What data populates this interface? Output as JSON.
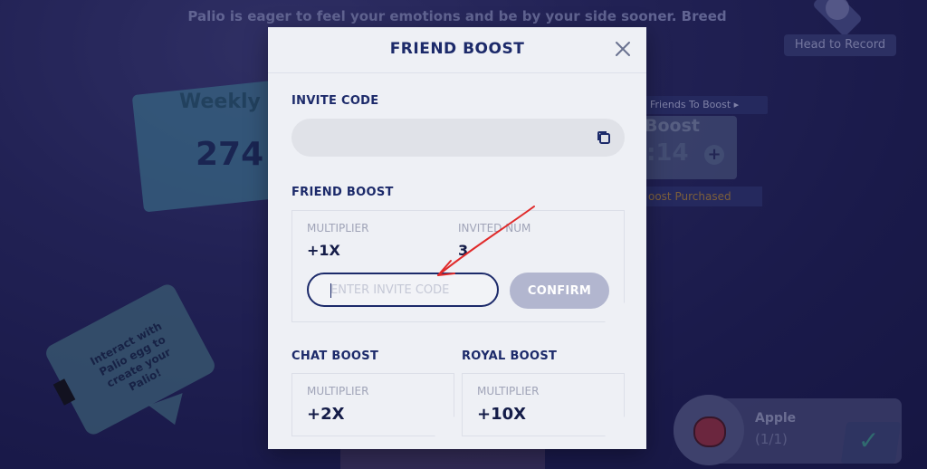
{
  "background": {
    "message": "Palio is eager to feel your emotions and be by your side sooner. Breed your Palio!",
    "weekly_title": "Weekly",
    "weekly_value": "274",
    "head_to_record": "Head to Record",
    "invite_friends_tag": "Friends To Boost",
    "boost_title": "Boost",
    "boost_value": "14",
    "boost_purchased": "oost Purchased",
    "bubble_text": "Interact with Palio egg to create your Palio!",
    "apple_name": "Apple",
    "apple_count": "(1/1)"
  },
  "modal": {
    "title": "FRIEND BOOST",
    "invite_code_label": "INVITE CODE",
    "invite_code_value": "",
    "friend_boost_label": "FRIEND BOOST",
    "friend_boost": {
      "multiplier_label": "MULTIPLIER",
      "multiplier_value": "+1X",
      "invited_label": "INVITED NUM",
      "invited_value": "3",
      "input_placeholder": "ENTER INVITE CODE",
      "confirm_label": "CONFIRM"
    },
    "chat_boost": {
      "label": "CHAT BOOST",
      "multiplier_label": "MULTIPLIER",
      "multiplier_value": "+2X"
    },
    "royal_boost": {
      "label": "ROYAL BOOST",
      "multiplier_label": "MULTIPLIER",
      "multiplier_value": "+10X"
    }
  },
  "colors": {
    "navy": "#1c2a6a",
    "modal_bg": "#eef0f5",
    "confirm_disabled": "#b2b6cf",
    "annotation_arrow": "#e02a2a"
  },
  "icons": [
    "close-icon",
    "copy-icon",
    "fist-icon",
    "plus-icon",
    "check-icon",
    "apple-icon"
  ]
}
